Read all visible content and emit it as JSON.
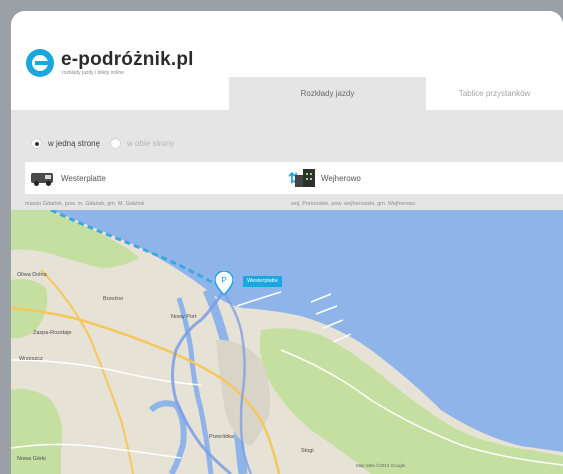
{
  "app": {
    "logo_text": "e-podróżnik.pl",
    "tagline": "rozkłady jazdy i bilety online"
  },
  "tabs": [
    {
      "label": "Rozkłady jazdy",
      "active": true
    },
    {
      "label": "Tablice przystanków",
      "active": false
    }
  ],
  "trip_type": {
    "options": [
      {
        "label": "w jedną stronę",
        "checked": true
      },
      {
        "label": "w obie strony",
        "checked": false
      }
    ]
  },
  "route": {
    "from_value": "Westerplatte",
    "to_value": "Wejherowo",
    "from_hint": "miasto Gdańsk, pow. m. Gdańsk, gm. M. Gdańsk",
    "to_hint": "woj. Pomorskie, pow. wejherowski, gm. Wejherowo"
  },
  "map": {
    "pin_label": "Westerplatte",
    "places": [
      "Nowy Port",
      "Przeróbka",
      "Stogi",
      "Brzeźno",
      "Zaspa-Rozstaje",
      "Wrzeszcz",
      "Oliwa Dolna",
      "Nowa Górki"
    ],
    "copyright": "Map data ©2013 Google"
  },
  "colors": {
    "accent": "#1aa7df",
    "water": "#8fb4e9",
    "land": "#e6e2d6",
    "park": "#c5dfa0"
  }
}
